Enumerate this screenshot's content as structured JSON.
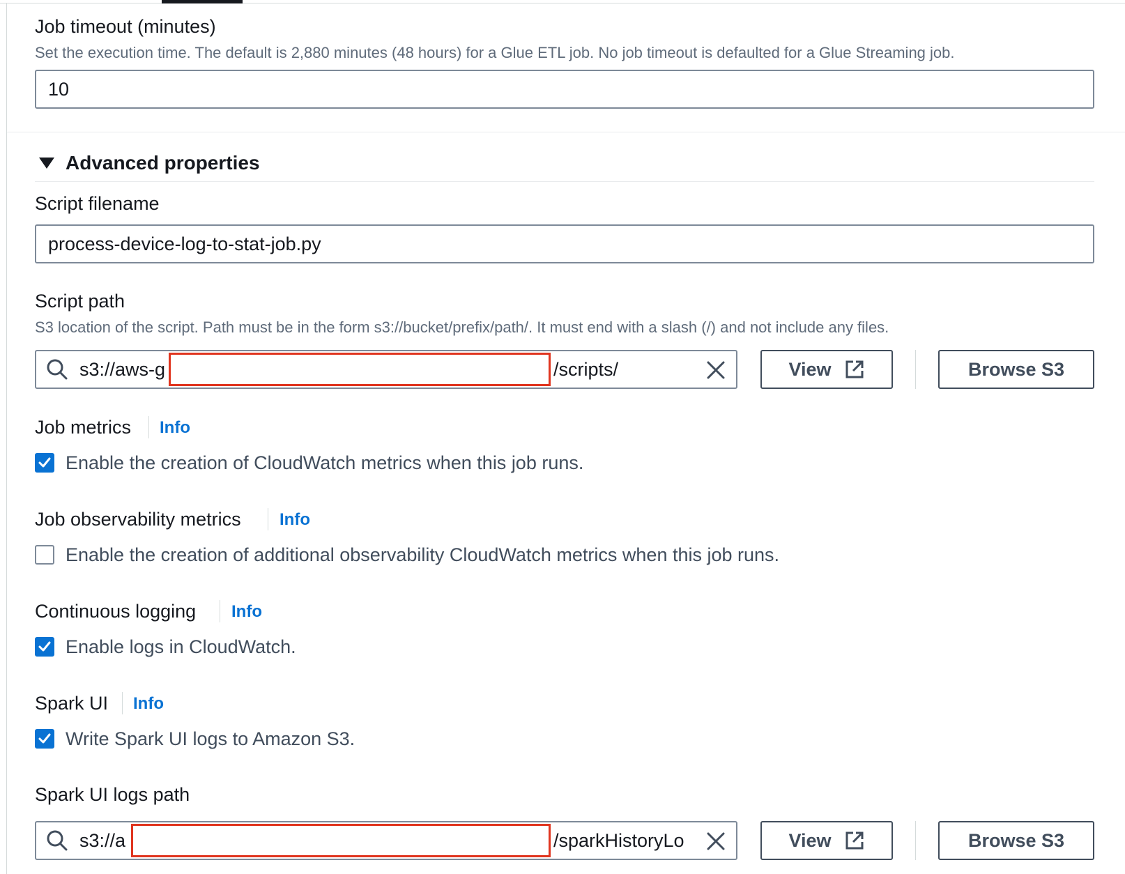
{
  "job_timeout": {
    "label": "Job timeout (minutes)",
    "description": "Set the execution time. The default is 2,880 minutes (48 hours) for a Glue ETL job. No job timeout is defaulted for a Glue Streaming job.",
    "value": "10"
  },
  "advanced": {
    "title": "Advanced properties"
  },
  "script_filename": {
    "label": "Script filename",
    "value": "process-device-log-to-stat-job.py"
  },
  "script_path": {
    "label": "Script path",
    "description": "S3 location of the script. Path must be in the form s3://bucket/prefix/path/. It must end with a slash (/) and not include any files.",
    "value_prefix": "s3://aws-g",
    "value_suffix": "/scripts/",
    "view_label": "View",
    "browse_label": "Browse S3"
  },
  "job_metrics": {
    "label": "Job metrics",
    "info": "Info",
    "checkbox_label": "Enable the creation of CloudWatch metrics when this job runs.",
    "checked": true
  },
  "job_observability_metrics": {
    "label": "Job observability metrics",
    "info": "Info",
    "checkbox_label": "Enable the creation of additional observability CloudWatch metrics when this job runs.",
    "checked": false
  },
  "continuous_logging": {
    "label": "Continuous logging",
    "info": "Info",
    "checkbox_label": "Enable logs in CloudWatch.",
    "checked": true
  },
  "spark_ui": {
    "label": "Spark UI",
    "info": "Info",
    "checkbox_label": "Write Spark UI logs to Amazon S3.",
    "checked": true
  },
  "spark_ui_logs_path": {
    "label": "Spark UI logs path",
    "value_prefix": "s3://a",
    "value_suffix": "/sparkHistoryLo",
    "view_label": "View",
    "browse_label": "Browse S3"
  },
  "colors": {
    "accent": "#0972d3",
    "redaction": "#e0351f",
    "text": "#16191f",
    "secondary_text": "#5f6b7a"
  },
  "icons": [
    "search-icon",
    "close-icon",
    "external-link-icon",
    "caret-down-icon",
    "checkmark-icon"
  ]
}
